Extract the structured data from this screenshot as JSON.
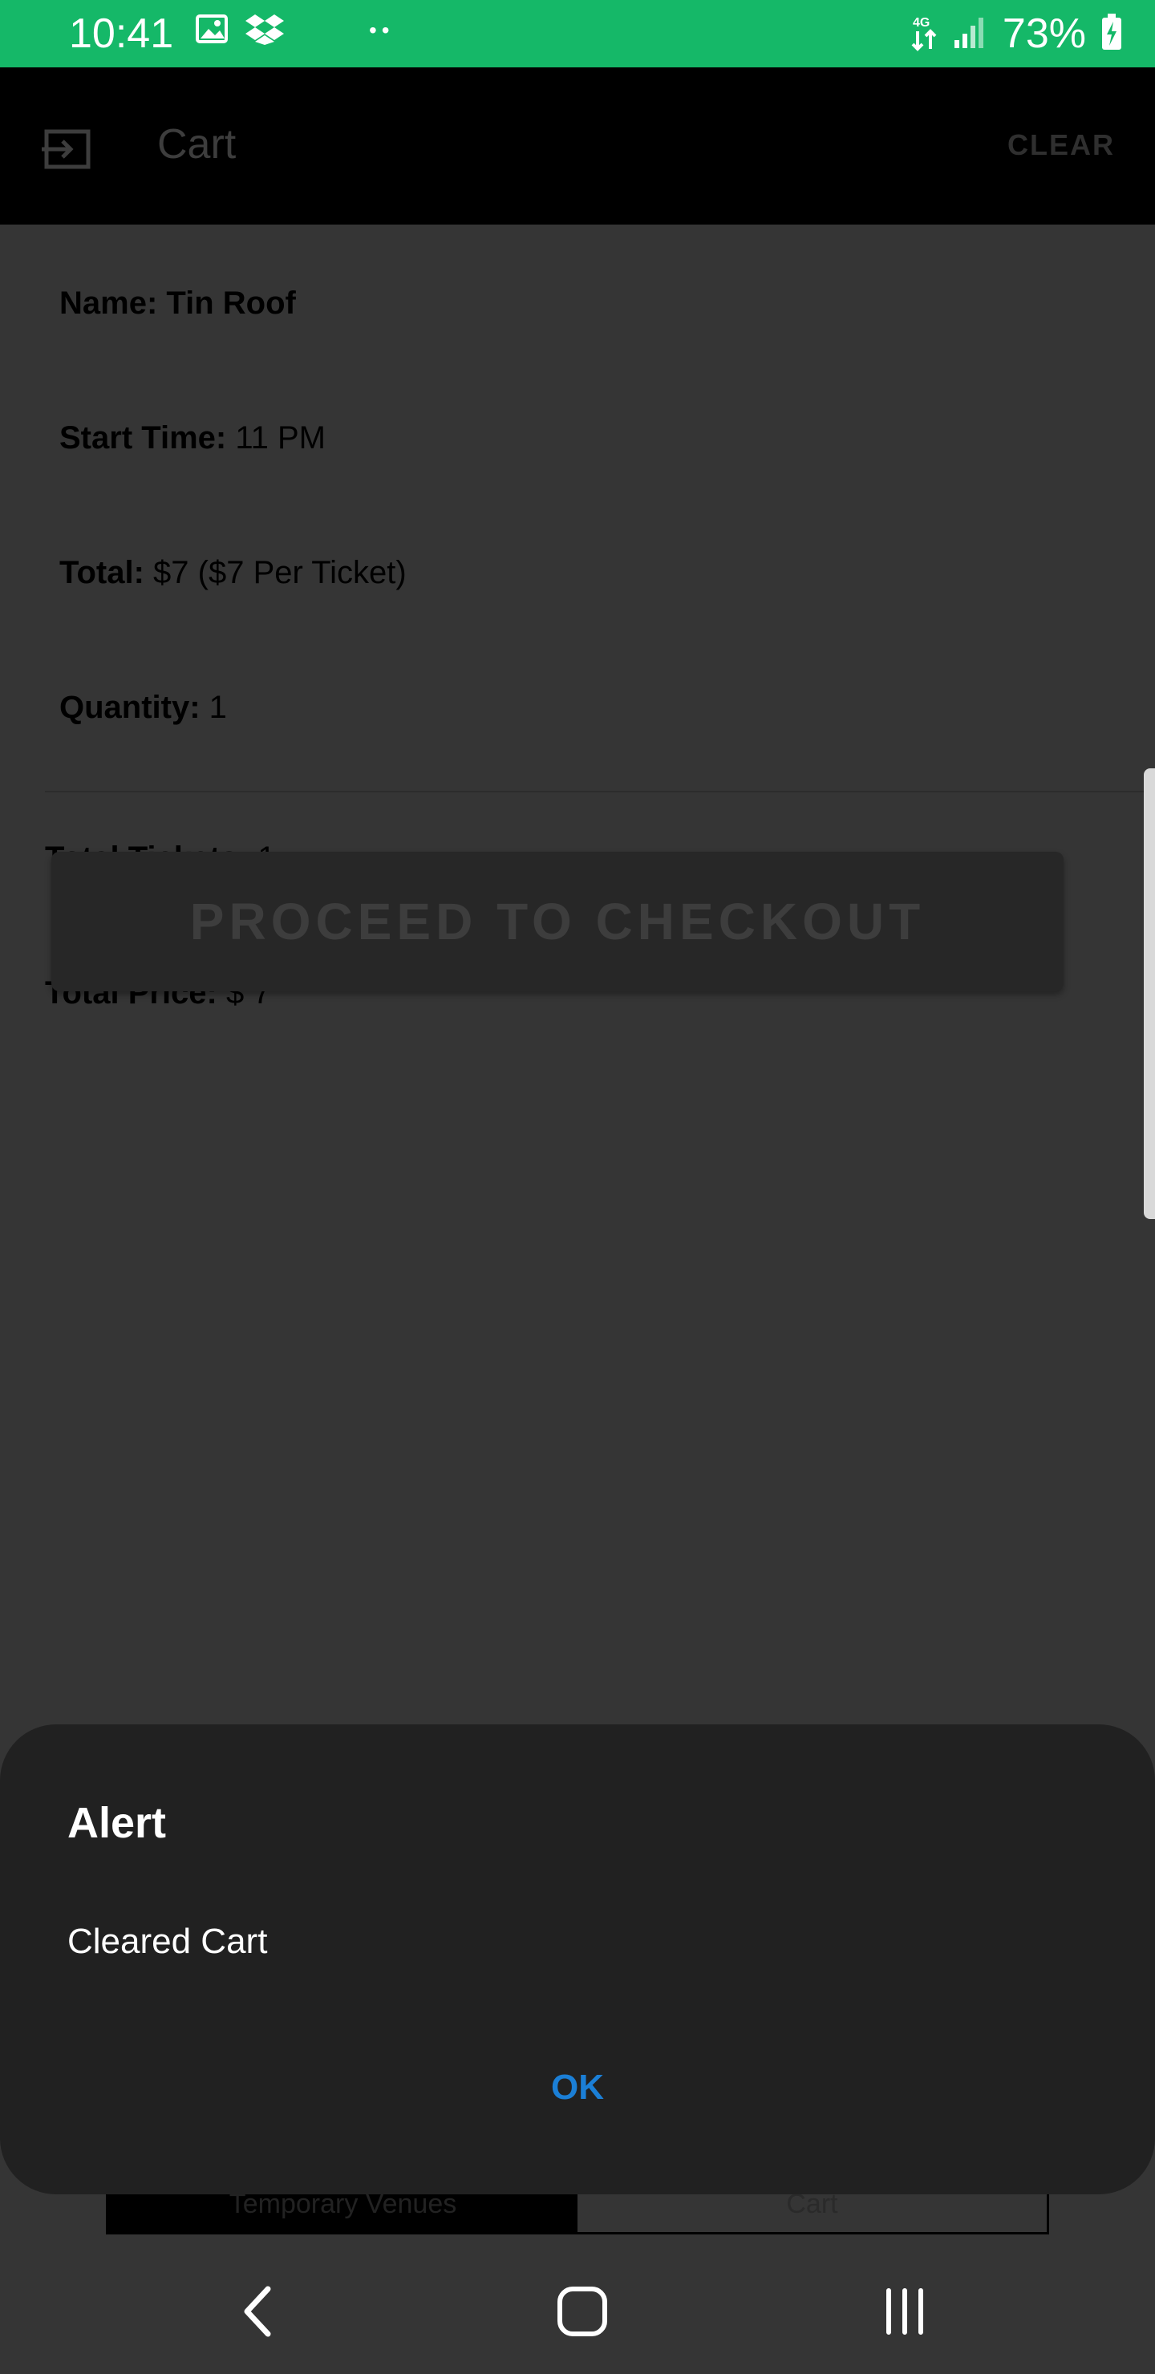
{
  "status": {
    "time": "10:41",
    "battery": "73%",
    "icons": [
      "image-icon",
      "dropbox-icon",
      "more-dots-icon",
      "4g-data-icon",
      "signal-icon",
      "battery-charging-icon"
    ]
  },
  "appbar": {
    "title": "Cart",
    "clear_label": "CLEAR",
    "back_icon": "logout-arrow-icon"
  },
  "cart_item": {
    "name_label": "Name:",
    "name_value": "Tin Roof",
    "start_time_label": "Start Time:",
    "start_time_value": "11 PM",
    "total_label": "Total:",
    "total_value": "$7 ($7 Per Ticket)",
    "quantity_label": "Quantity:",
    "quantity_value": "1"
  },
  "summary": {
    "total_tickets_label": "Total Tickets:",
    "total_tickets_value": "1",
    "total_price_label": "Total Price:",
    "total_price_value": "$ 7"
  },
  "checkout_label": "PROCEED TO CHECKOUT",
  "tabs": [
    {
      "label": "Temporary Venues"
    },
    {
      "label": "Cart"
    }
  ],
  "alert": {
    "title": "Alert",
    "message": "Cleared Cart",
    "ok_label": "OK"
  },
  "colors": {
    "status_bar": "#15b868",
    "ok_button": "#1b7fd6",
    "background": "#353535",
    "dialog": "#212121"
  }
}
